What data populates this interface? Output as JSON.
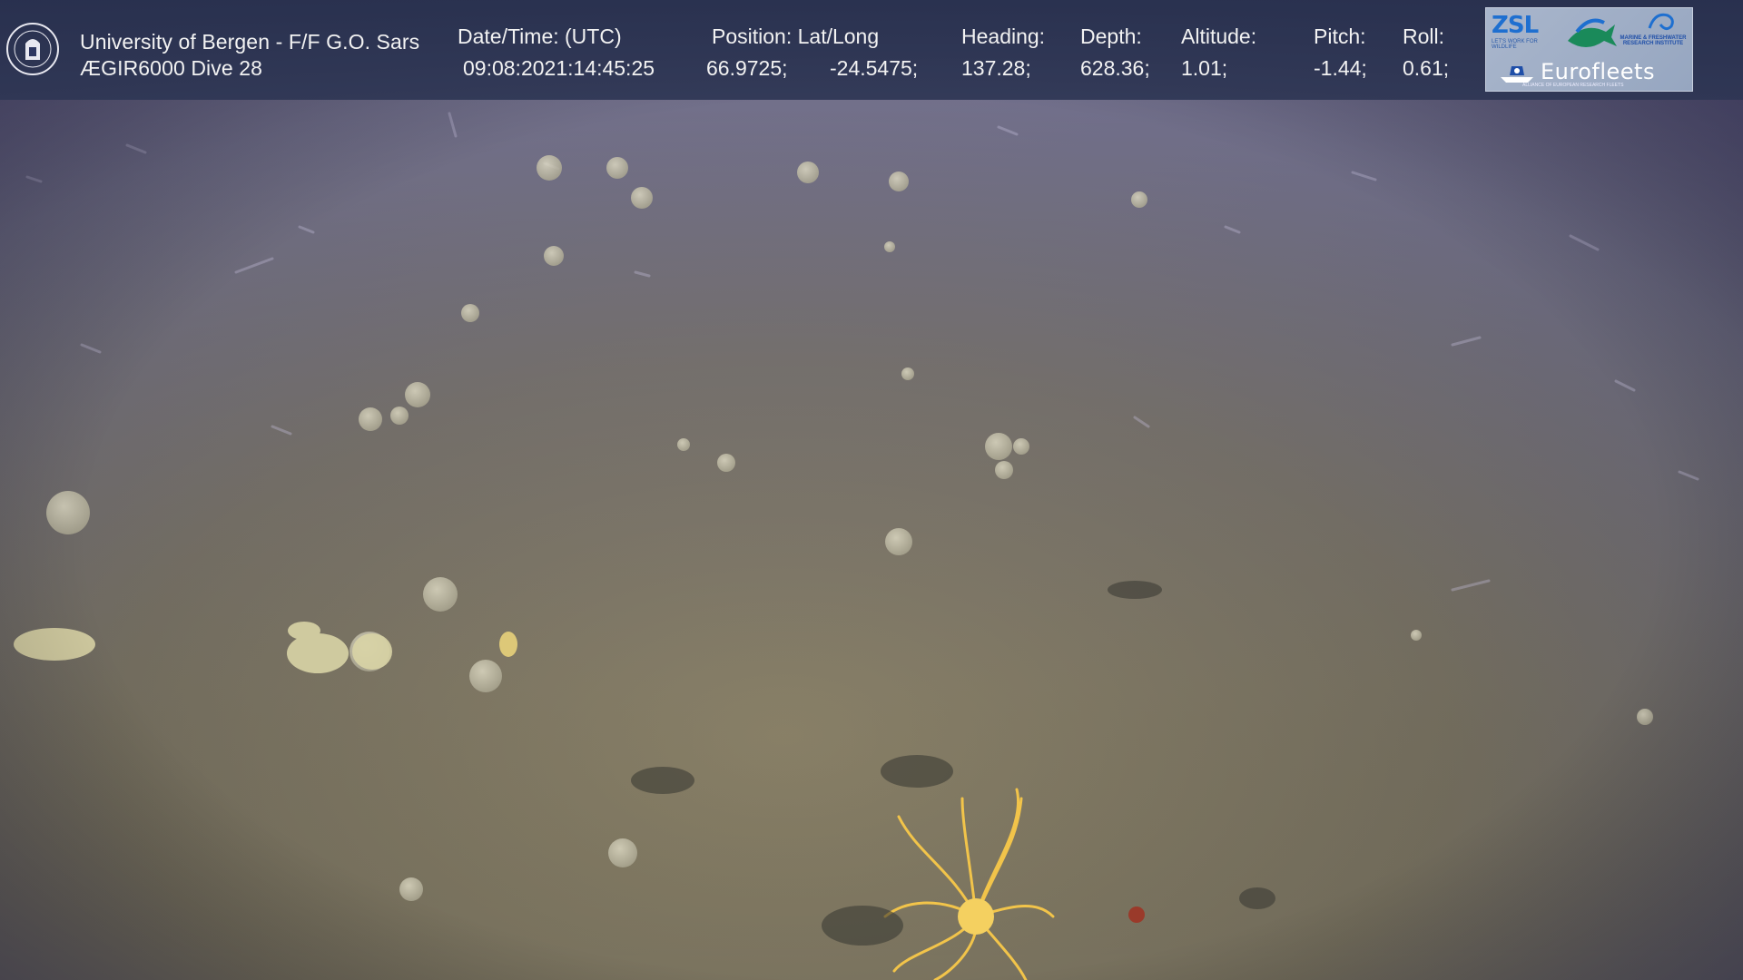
{
  "overlay": {
    "institution": "University of Bergen - F/F G.O. Sars",
    "dive": "ÆGIR6000 Dive 28",
    "fields": [
      {
        "key": "datetime",
        "label": "Date/Time: (UTC)",
        "value": "09:08:2021:14:45:25"
      },
      {
        "key": "position",
        "label": "Position: Lat/Long",
        "lat": "66.9725;",
        "long": "-24.5475;"
      },
      {
        "key": "heading",
        "label": "Heading:",
        "value": "137.28;"
      },
      {
        "key": "depth",
        "label": "Depth:",
        "value": "628.36;"
      },
      {
        "key": "altitude",
        "label": "Altitude:",
        "value": "1.01;"
      },
      {
        "key": "pitch",
        "label": "Pitch:",
        "value": "-1.44;"
      },
      {
        "key": "roll",
        "label": "Roll:",
        "value": "0.61;"
      }
    ],
    "logos": {
      "zsl": "ZSL",
      "zsl_sub": "LET'S WORK FOR WILDLIFE",
      "mri": "MARINE & FRESHWATER RESEARCH INSTITUTE",
      "eurofleets": "Eurofleets",
      "eurofleets_tag": "ALLIANCE OF EUROPEAN RESEARCH FLEETS"
    }
  },
  "scene": {
    "description_icon": "seafloor-camera-view",
    "colors": {
      "sediment": "#7a7360",
      "water_haze": "#6e6c8c",
      "sponge": "#c8c3a6",
      "basket_star": "#f0c040"
    }
  }
}
